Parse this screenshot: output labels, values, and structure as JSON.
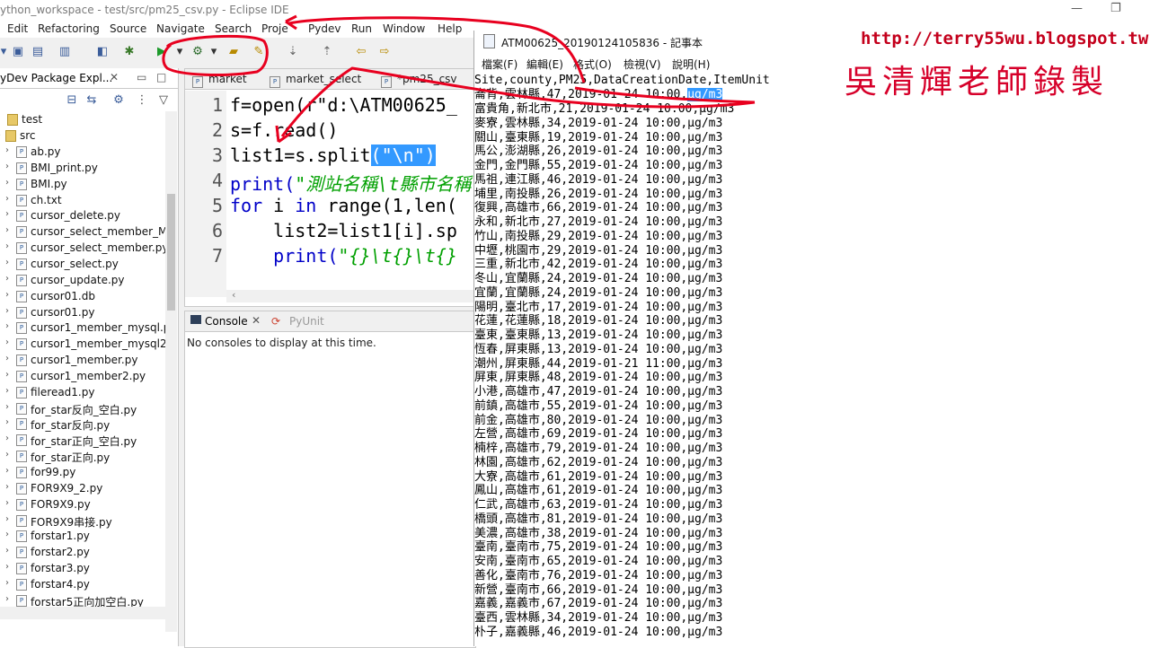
{
  "eclipse": {
    "title": "ython_workspace - test/src/pm25_csv.py - Eclipse IDE",
    "menu": [
      "Edit",
      "Refactoring",
      "Source",
      "Navigate",
      "Search",
      "Proje",
      "Pydev",
      "Run",
      "Window",
      "Help"
    ],
    "package_explorer": {
      "tab_label": "yDev Package Expl...",
      "project": "test",
      "folder": "src",
      "files": [
        "ab.py",
        "BMI_print.py",
        "BMI.py",
        "ch.txt",
        "cursor_delete.py",
        "cursor_select_member_M",
        "cursor_select_member.py",
        "cursor_select.py",
        "cursor_update.py",
        "cursor01.db",
        "cursor01.py",
        "cursor1_member_mysql.p",
        "cursor1_member_mysql2",
        "cursor1_member.py",
        "cursor1_member2.py",
        "fileread1.py",
        "for_star反向_空白.py",
        "for_star反向.py",
        "for_star正向_空白.py",
        "for_star正向.py",
        "for99.py",
        "FOR9X9_2.py",
        "FOR9X9.py",
        "FOR9X9串接.py",
        "forstar1.py",
        "forstar2.py",
        "forstar3.py",
        "forstar4.py",
        "forstar5正向加空白.py"
      ]
    },
    "editor": {
      "tabs": [
        "market",
        "market_select",
        "*pm25_csv"
      ],
      "line_numbers": [
        "1",
        "2",
        "3",
        "4",
        "5",
        "6",
        "7"
      ],
      "code": {
        "l1": "f=open(r\"d:\\ATM00625_",
        "l2": "s=f.read()",
        "l3_pre": "list1=s.split",
        "l3_sel": "(\"\\n\")",
        "l4_pre": "print(",
        "l4_str": "\"測站名稱\\t縣市名稱",
        "l5_kw1": "for",
        "l5_mid": " i ",
        "l5_kw2": "in",
        "l5_rest": " range(1,len(",
        "l6": "    list2=list1[i].sp",
        "l7_pre": "    print(",
        "l7_str": "\"{}\\t{}\\t{}"
      }
    },
    "console": {
      "tab_console": "Console",
      "tab_pyunit": "PyUnit",
      "message": "No consoles to display at this time."
    }
  },
  "notepad": {
    "title": "ATM00625_20190124105836 - 記事本",
    "menu": [
      "檔案(F)",
      "編輯(E)",
      "格式(O)",
      "檢視(V)",
      "說明(H)"
    ],
    "header_line": "Site,county,PM25,DataCreationDate,ItemUnit",
    "first_row_prefix": "崙背,雲林縣,47,2019-01-24 10:00,",
    "first_row_selected": "μg/m3",
    "rows": [
      "富貴角,新北市,21,2019-01-24 10:00,μg/m3",
      "麥寮,雲林縣,34,2019-01-24 10:00,μg/m3",
      "關山,臺東縣,19,2019-01-24 10:00,μg/m3",
      "馬公,澎湖縣,26,2019-01-24 10:00,μg/m3",
      "金門,金門縣,55,2019-01-24 10:00,μg/m3",
      "馬祖,連江縣,46,2019-01-24 10:00,μg/m3",
      "埔里,南投縣,26,2019-01-24 10:00,μg/m3",
      "復興,高雄市,66,2019-01-24 10:00,μg/m3",
      "永和,新北市,27,2019-01-24 10:00,μg/m3",
      "竹山,南投縣,29,2019-01-24 10:00,μg/m3",
      "中壢,桃園市,29,2019-01-24 10:00,μg/m3",
      "三重,新北市,42,2019-01-24 10:00,μg/m3",
      "冬山,宜蘭縣,24,2019-01-24 10:00,μg/m3",
      "宜蘭,宜蘭縣,24,2019-01-24 10:00,μg/m3",
      "陽明,臺北市,17,2019-01-24 10:00,μg/m3",
      "花蓮,花蓮縣,18,2019-01-24 10:00,μg/m3",
      "臺東,臺東縣,13,2019-01-24 10:00,μg/m3",
      "恆春,屏東縣,13,2019-01-24 10:00,μg/m3",
      "潮州,屏東縣,44,2019-01-21 11:00,μg/m3",
      "屏東,屏東縣,48,2019-01-24 10:00,μg/m3",
      "小港,高雄市,47,2019-01-24 10:00,μg/m3",
      "前鎮,高雄市,55,2019-01-24 10:00,μg/m3",
      "前金,高雄市,80,2019-01-24 10:00,μg/m3",
      "左營,高雄市,69,2019-01-24 10:00,μg/m3",
      "楠梓,高雄市,79,2019-01-24 10:00,μg/m3",
      "林園,高雄市,62,2019-01-24 10:00,μg/m3",
      "大寮,高雄市,61,2019-01-24 10:00,μg/m3",
      "鳳山,高雄市,61,2019-01-24 10:00,μg/m3",
      "仁武,高雄市,63,2019-01-24 10:00,μg/m3",
      "橋頭,高雄市,81,2019-01-24 10:00,μg/m3",
      "美濃,高雄市,38,2019-01-24 10:00,μg/m3",
      "臺南,臺南市,75,2019-01-24 10:00,μg/m3",
      "安南,臺南市,65,2019-01-24 10:00,μg/m3",
      "善化,臺南市,76,2019-01-24 10:00,μg/m3",
      "新營,臺南市,66,2019-01-24 10:00,μg/m3",
      "嘉義,嘉義市,67,2019-01-24 10:00,μg/m3",
      "臺西,雲林縣,34,2019-01-24 10:00,μg/m3",
      "朴子,嘉義縣,46,2019-01-24 10:00,μg/m3"
    ]
  },
  "watermark": {
    "url": "http://terry55wu.blogspot.tw",
    "name": "吳清輝老師錄製"
  },
  "colors": {
    "annotation": "#e8001f",
    "keyword": "#0000c8",
    "string": "#00a000",
    "selection": "#3399ff"
  }
}
